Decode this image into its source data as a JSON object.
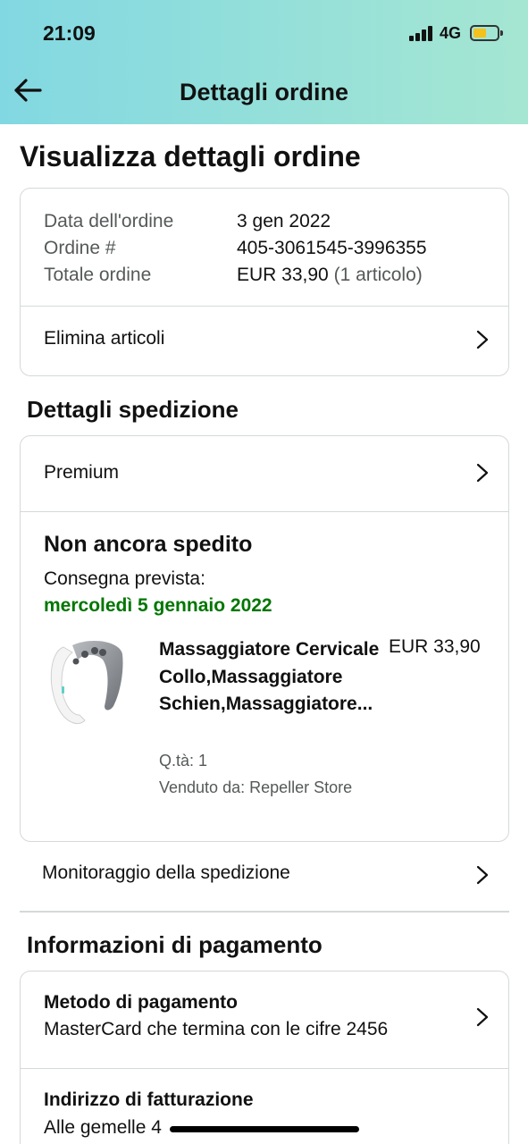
{
  "status_bar": {
    "time": "21:09",
    "network": "4G"
  },
  "nav": {
    "title": "Dettagli ordine"
  },
  "page": {
    "title": "Visualizza dettagli ordine"
  },
  "order_summary": {
    "date_label": "Data dell'ordine",
    "date_value": "3 gen 2022",
    "number_label": "Ordine #",
    "number_value": "405-3061545-3996355",
    "total_label": "Totale ordine",
    "total_value": "EUR 33,90",
    "total_items": "(1 articolo)",
    "delete_items": "Elimina articoli"
  },
  "shipping": {
    "section_title": "Dettagli spedizione",
    "method": "Premium",
    "status": "Non ancora spedito",
    "delivery_label": "Consegna prevista:",
    "delivery_date": "mercoledì 5 gennaio 2022",
    "product": {
      "name": "Massaggiatore Cervicale Collo,Massaggiatore Schien,Massaggiatore...",
      "price": "EUR 33,90",
      "quantity": "Q.tà: 1",
      "seller": "Venduto da: Repeller Store"
    },
    "tracking": "Monitoraggio della spedizione"
  },
  "payment": {
    "section_title": "Informazioni di pagamento",
    "method_title": "Metodo di pagamento",
    "method_value": "MasterCard che termina con le cifre 2456",
    "billing_title": "Indirizzo di fatturazione",
    "billing_value": "Alle gemelle 4"
  },
  "colors": {
    "header_start": "#82d8e2",
    "header_end": "#a5e6d2",
    "delivery_green": "#007600",
    "battery": "#f4c21a"
  },
  "icons": [
    "back-arrow-icon",
    "chevron-right-icon",
    "signal-icon",
    "battery-icon"
  ]
}
